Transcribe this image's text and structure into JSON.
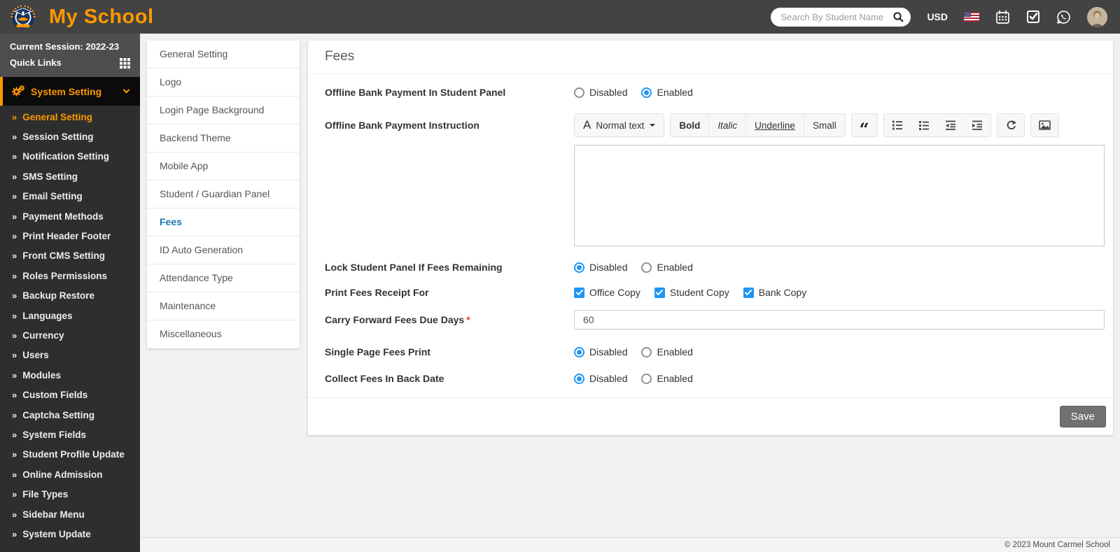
{
  "header": {
    "app_title": "My School",
    "search_placeholder": "Search By Student Name",
    "currency": "USD",
    "icons": [
      "search-icon",
      "us-flag-icon",
      "calendar-icon",
      "task-check-icon",
      "whatsapp-icon",
      "avatar"
    ]
  },
  "sidebar": {
    "session_label": "Current Session: 2022-23",
    "quick_links_label": "Quick Links",
    "section_label": "System Setting",
    "section_icon": "gears-icon",
    "item_bullet": "»",
    "items": [
      "General Setting",
      "Session Setting",
      "Notification Setting",
      "SMS Setting",
      "Email Setting",
      "Payment Methods",
      "Print Header Footer",
      "Front CMS Setting",
      "Roles Permissions",
      "Backup Restore",
      "Languages",
      "Currency",
      "Users",
      "Modules",
      "Custom Fields",
      "Captcha Setting",
      "System Fields",
      "Student Profile Update",
      "Online Admission",
      "File Types",
      "Sidebar Menu",
      "System Update"
    ],
    "active_item": "General Setting"
  },
  "settings_nav": {
    "items": [
      "General Setting",
      "Logo",
      "Login Page Background",
      "Backend Theme",
      "Mobile App",
      "Student / Guardian Panel",
      "Fees",
      "ID Auto Generation",
      "Attendance Type",
      "Maintenance",
      "Miscellaneous"
    ],
    "active_item": "Fees"
  },
  "page": {
    "title": "Fees"
  },
  "fields": {
    "offline_bank_payment": {
      "label": "Offline Bank Payment In Student Panel",
      "options": [
        "Disabled",
        "Enabled"
      ],
      "value": "Enabled"
    },
    "offline_instruction": {
      "label": "Offline Bank Payment Instruction",
      "style_button": "Normal text",
      "format_buttons": [
        "Bold",
        "Italic",
        "Underline",
        "Small"
      ],
      "toolbar_icons": [
        "blockquote-icon",
        "ordered-list-icon",
        "unordered-list-icon",
        "outdent-icon",
        "indent-icon",
        "redo-icon",
        "image-icon"
      ],
      "content": ""
    },
    "lock_student_panel": {
      "label": "Lock Student Panel If Fees Remaining",
      "options": [
        "Disabled",
        "Enabled"
      ],
      "value": "Disabled"
    },
    "print_fees_receipt": {
      "label": "Print Fees Receipt For",
      "options": [
        {
          "label": "Office Copy",
          "checked": true
        },
        {
          "label": "Student Copy",
          "checked": true
        },
        {
          "label": "Bank Copy",
          "checked": true
        }
      ]
    },
    "carry_forward_days": {
      "label": "Carry Forward Fees Due Days",
      "required_marker": "*",
      "value": "60"
    },
    "single_page_fees_print": {
      "label": "Single Page Fees Print",
      "options": [
        "Disabled",
        "Enabled"
      ],
      "value": "Disabled"
    },
    "collect_fees_back_date": {
      "label": "Collect Fees In Back Date",
      "options": [
        "Disabled",
        "Enabled"
      ],
      "value": "Disabled"
    }
  },
  "actions": {
    "save_label": "Save"
  },
  "footer": {
    "copyright": "© 2023 Mount Carmel School"
  },
  "colors": {
    "accent_orange": "#ff9800",
    "active_nav_blue": "#1578b5",
    "control_blue": "#2196f3",
    "header_bg": "#434343",
    "sidebar_bg": "#2e2e2e"
  }
}
